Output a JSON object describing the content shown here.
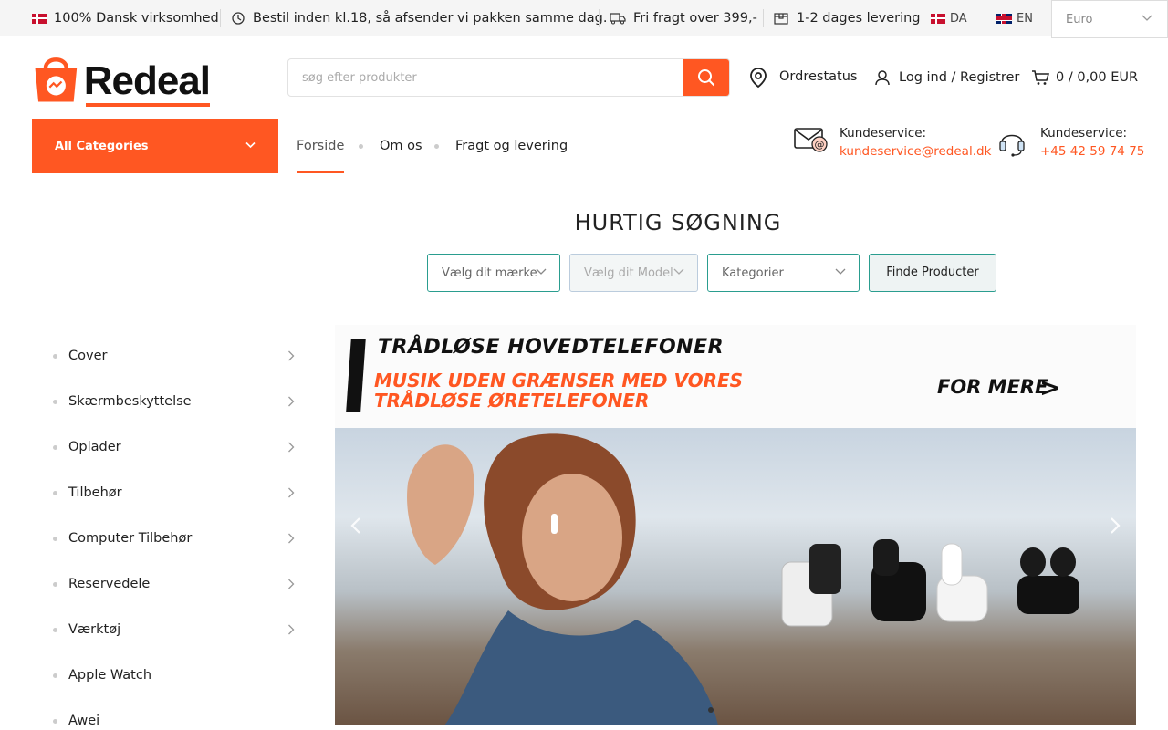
{
  "topbar": {
    "danish_company": "100% Dansk virksomhed",
    "order_before": "Bestil inden kl.18, så afsender vi pakken samme dag.",
    "free_shipping": "Fri fragt over 399,-",
    "delivery_time": "1-2 dages levering",
    "lang_da": "DA",
    "lang_en": "EN",
    "currency": "Euro"
  },
  "header": {
    "logo_text": "Redeal",
    "search_placeholder": "søg efter produkter",
    "order_status": "Ordrestatus",
    "login": "Log ind / Registrer",
    "cart": "0 / 0,00 EUR"
  },
  "nav": {
    "all_categories": "All Categories",
    "items": [
      {
        "label": "Forside",
        "active": true
      },
      {
        "label": "Om os"
      },
      {
        "label": "Fragt og levering"
      }
    ],
    "customer_service_email_label": "Kundeservice:",
    "customer_service_email": "kundeservice@redeal.dk",
    "customer_service_phone_label": "Kundeservice:",
    "customer_service_phone": "+45 42 59 74 75"
  },
  "quick_search": {
    "title": "HURTIG SØGNING",
    "brand_placeholder": "Vælg dit mærke",
    "model_placeholder": "Vælg dit Model",
    "category_placeholder": "Kategorier",
    "button": "Finde Producter"
  },
  "categories": [
    {
      "label": "Cover",
      "has_sub": true
    },
    {
      "label": "Skærmbeskyttelse",
      "has_sub": true
    },
    {
      "label": "Oplader",
      "has_sub": true
    },
    {
      "label": "Tilbehør",
      "has_sub": true
    },
    {
      "label": "Computer Tilbehør",
      "has_sub": true
    },
    {
      "label": "Reservedele",
      "has_sub": true
    },
    {
      "label": "Værktøj",
      "has_sub": true
    },
    {
      "label": "Apple Watch",
      "has_sub": false
    },
    {
      "label": "Awei",
      "has_sub": false
    }
  ],
  "banner": {
    "headline": "TRÅDLØSE HOVEDTELEFONER",
    "subline": "MUSIK UDEN GRÆNSER MED VORES  TRÅDLØSE ØRETELEFONER",
    "cta": "FOR MERE",
    "cta_arrow": ">"
  },
  "colors": {
    "accent": "#ff5722",
    "teal_border": "#2a9d8f",
    "topbar_bg": "#f5f5f5"
  }
}
